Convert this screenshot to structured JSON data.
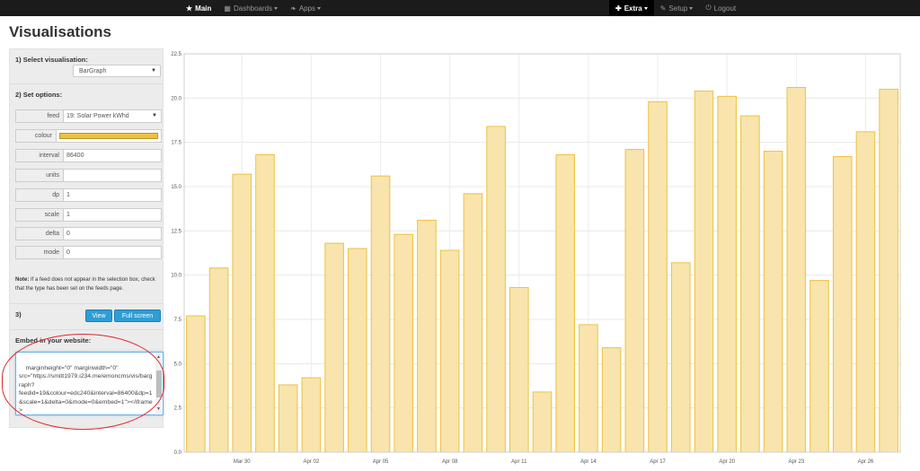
{
  "nav": {
    "main": "Main",
    "dashboards": "Dashboards",
    "apps": "Apps",
    "extra": "Extra",
    "setup": "Setup",
    "logout": "Logout"
  },
  "page_title": "Visualisations",
  "panel": {
    "section1_title": "1) Select visualisation:",
    "visualisation_value": "BarGraph",
    "section2_title": "2) Set options:",
    "options": [
      {
        "label": "feed",
        "value": "19: Solar Power kWhd"
      },
      {
        "label": "colour",
        "value": "#edc240"
      },
      {
        "label": "interval",
        "value": "86400"
      },
      {
        "label": "units",
        "value": ""
      },
      {
        "label": "dp",
        "value": "1"
      },
      {
        "label": "scale",
        "value": "1"
      },
      {
        "label": "delta",
        "value": "0"
      },
      {
        "label": "mode",
        "value": "0"
      }
    ],
    "note_bold": "Note:",
    "note_text": " If a feed does not appear in the selection box, check that the type has been set on the feeds page.",
    "section3_title": "3)",
    "view_button": "View",
    "fullscreen_button": "Full screen",
    "embed_title": "Embed in your website:",
    "embed_code": "marginheight=\"0\" marginwidth=\"0\"\nsrc=\"https://smitt1979.i234.me/emoncms/vis/bargraph?\nfeedid=19&colour=edc240&interval=86400&dp=1&scale=1&delta=0&mode=0&embed=1\"></iframe>"
  },
  "colors": {
    "bar_fill": "#f8e4ac",
    "bar_stroke": "#edc240",
    "accent_button": "#2f9ed6",
    "annotation_ring": "#e0262a"
  },
  "chart_data": {
    "type": "bar",
    "ylim": [
      0,
      22.5
    ],
    "yticks": [
      "0.0",
      "2.5",
      "5.0",
      "7.5",
      "10.0",
      "12.5",
      "15.0",
      "17.5",
      "20.0",
      "22.5"
    ],
    "xticks": [
      "Mar 30",
      "Apr 02",
      "Apr 05",
      "Apr 08",
      "Apr 11",
      "Apr 14",
      "Apr 17",
      "Apr 20",
      "Apr 23",
      "Apr 26"
    ],
    "values": [
      7.7,
      10.4,
      15.7,
      16.8,
      3.8,
      4.2,
      11.8,
      11.5,
      15.6,
      12.3,
      13.1,
      11.4,
      14.6,
      18.4,
      9.3,
      3.4,
      16.8,
      7.2,
      5.9,
      17.1,
      19.8,
      10.7,
      20.4,
      20.1,
      19.0,
      17.0,
      20.6,
      9.7,
      16.7,
      18.1,
      20.5
    ],
    "grid": true
  }
}
